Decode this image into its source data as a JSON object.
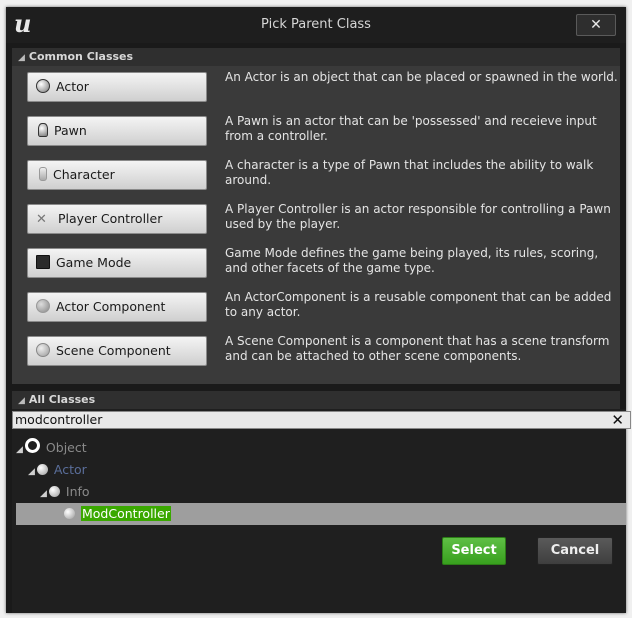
{
  "window": {
    "title": "Pick Parent Class",
    "logo_text": "u",
    "close_label": "✕"
  },
  "common": {
    "header": "Common Classes",
    "items": [
      {
        "label": "Actor",
        "icon": "actor-sphere-icon",
        "description": "An Actor is an object that can be placed or spawned in the world."
      },
      {
        "label": "Pawn",
        "icon": "pawn-icon",
        "description": "A Pawn is an actor that can be 'possessed' and receieve input from a controller."
      },
      {
        "label": "Character",
        "icon": "character-icon",
        "description": "A character is a type of Pawn that includes the ability to walk around."
      },
      {
        "label": "Player Controller",
        "icon": "player-controller-icon",
        "description": "A Player Controller is an actor responsible for controlling a Pawn used by the player."
      },
      {
        "label": "Game Mode",
        "icon": "game-mode-icon",
        "description": "Game Mode defines the game being played, its rules, scoring, and other facets of the game type."
      },
      {
        "label": "Actor Component",
        "icon": "actor-component-icon",
        "description": "An ActorComponent is a reusable component that can be added to any actor."
      },
      {
        "label": "Scene Component",
        "icon": "scene-component-icon",
        "description": "A Scene Component is a component that has a scene transform and can be attached to other scene components."
      }
    ]
  },
  "all": {
    "header": "All Classes",
    "search_value": "modcontroller",
    "search_clear": "✕",
    "tree": {
      "object": "Object",
      "actor": "Actor",
      "info": "Info",
      "selected": "ModController"
    }
  },
  "buttons": {
    "select": "Select",
    "cancel": "Cancel"
  },
  "colors": {
    "select_button": "#4caf2a",
    "highlight": "#3aa800",
    "window_bg": "#1a1a1a"
  }
}
